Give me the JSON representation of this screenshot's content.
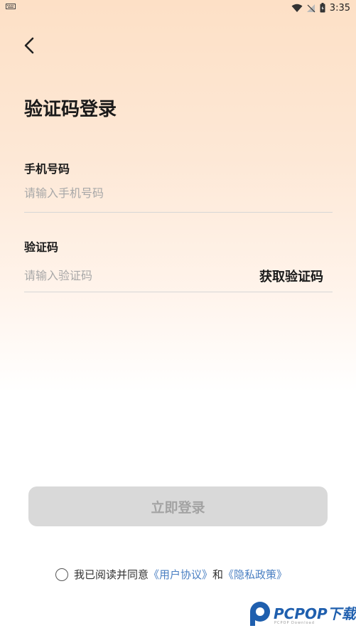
{
  "status_bar": {
    "time": "3:35"
  },
  "page": {
    "title": "验证码登录"
  },
  "phone": {
    "label": "手机号码",
    "placeholder": "请输入手机号码"
  },
  "code": {
    "label": "验证码",
    "placeholder": "请输入验证码",
    "get_code_label": "获取验证码"
  },
  "login_button": {
    "label": "立即登录"
  },
  "agreement": {
    "prefix": "我已阅读并同意",
    "user_agreement": "《用户协议》",
    "conjunction": "和",
    "privacy_policy": "《隐私政策》"
  },
  "watermark": {
    "brand": "PCPOP下载",
    "sub": "PCPOP Download"
  },
  "colors": {
    "link": "#4a7fc2",
    "button_bg": "#d9d9d9",
    "button_text": "#a3a3a3",
    "brand": "#1f5fae"
  }
}
